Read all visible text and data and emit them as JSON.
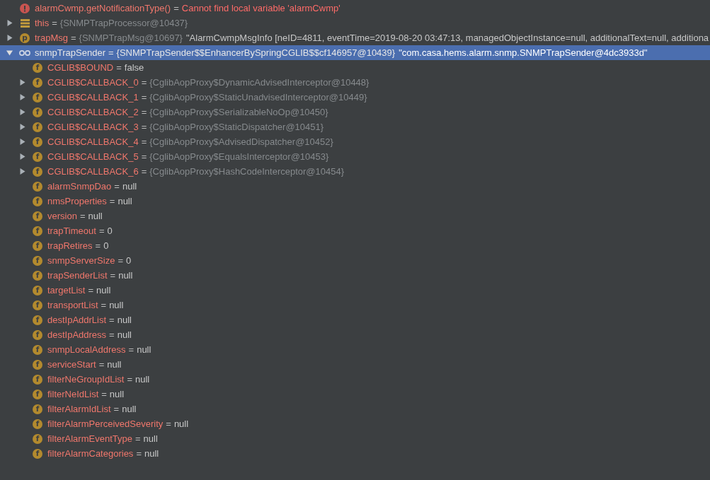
{
  "variables": [
    {
      "kind": "error",
      "name": "alarmCwmp.getNotificationType()",
      "op": "=",
      "message": "Cannot find local variable 'alarmCwmp'",
      "selected": false
    },
    {
      "kind": "object",
      "name": "this",
      "op": "=",
      "ref": "{SNMPTrapProcessor@10437}",
      "expanded": false,
      "selected": false
    },
    {
      "kind": "param",
      "badge": "p",
      "name": "trapMsg",
      "op": "=",
      "ref": "{SNMPTrapMsg@10697}",
      "value": "\"AlarmCwmpMsgInfo [neID=4811, eventTime=2019-08-20 03:47:13, managedObjectInstance=null, additionalText=null, additiona",
      "expanded": false,
      "selected": false
    },
    {
      "kind": "watch",
      "name": "snmpTrapSender",
      "op": "=",
      "ref": "{SNMPTrapSender$$EnhancerBySpringCGLIB$$cf146957@10439}",
      "value": "\"com.casa.hems.alarm.snmp.SNMPTrapSender@4dc3933d\"",
      "expanded": true,
      "selected": true,
      "children": [
        {
          "kind": "field",
          "badge": "f",
          "name": "CGLIB$BOUND",
          "op": "=",
          "value": "false",
          "selected": false
        },
        {
          "kind": "field",
          "badge": "f",
          "name": "CGLIB$CALLBACK_0",
          "op": "=",
          "ref": "{CglibAopProxy$DynamicAdvisedInterceptor@10448}",
          "expanded": false,
          "selected": false
        },
        {
          "kind": "field",
          "badge": "f",
          "name": "CGLIB$CALLBACK_1",
          "op": "=",
          "ref": "{CglibAopProxy$StaticUnadvisedInterceptor@10449}",
          "expanded": false,
          "selected": false
        },
        {
          "kind": "field",
          "badge": "f",
          "name": "CGLIB$CALLBACK_2",
          "op": "=",
          "ref": "{CglibAopProxy$SerializableNoOp@10450}",
          "expanded": false,
          "selected": false
        },
        {
          "kind": "field",
          "badge": "f",
          "name": "CGLIB$CALLBACK_3",
          "op": "=",
          "ref": "{CglibAopProxy$StaticDispatcher@10451}",
          "expanded": false,
          "selected": false
        },
        {
          "kind": "field",
          "badge": "f",
          "name": "CGLIB$CALLBACK_4",
          "op": "=",
          "ref": "{CglibAopProxy$AdvisedDispatcher@10452}",
          "expanded": false,
          "selected": false
        },
        {
          "kind": "field",
          "badge": "f",
          "name": "CGLIB$CALLBACK_5",
          "op": "=",
          "ref": "{CglibAopProxy$EqualsInterceptor@10453}",
          "expanded": false,
          "selected": false
        },
        {
          "kind": "field",
          "badge": "f",
          "name": "CGLIB$CALLBACK_6",
          "op": "=",
          "ref": "{CglibAopProxy$HashCodeInterceptor@10454}",
          "expanded": false,
          "selected": false
        },
        {
          "kind": "field",
          "badge": "f",
          "name": "alarmSnmpDao",
          "op": "=",
          "value": "null",
          "selected": false
        },
        {
          "kind": "field",
          "badge": "f",
          "name": "nmsProperties",
          "op": "=",
          "value": "null",
          "selected": false
        },
        {
          "kind": "field",
          "badge": "f",
          "name": "version",
          "op": "=",
          "value": "null",
          "selected": false
        },
        {
          "kind": "field",
          "badge": "f",
          "name": "trapTimeout",
          "op": "=",
          "value": "0",
          "selected": false
        },
        {
          "kind": "field",
          "badge": "f",
          "name": "trapRetires",
          "op": "=",
          "value": "0",
          "selected": false
        },
        {
          "kind": "field",
          "badge": "f",
          "name": "snmpServerSize",
          "op": "=",
          "value": "0",
          "selected": false
        },
        {
          "kind": "field",
          "badge": "f",
          "name": "trapSenderList",
          "op": "=",
          "value": "null",
          "selected": false
        },
        {
          "kind": "field",
          "badge": "f",
          "name": "targetList",
          "op": "=",
          "value": "null",
          "selected": false
        },
        {
          "kind": "field",
          "badge": "f",
          "name": "transportList",
          "op": "=",
          "value": "null",
          "selected": false
        },
        {
          "kind": "field",
          "badge": "f",
          "name": "destIpAddrList",
          "op": "=",
          "value": "null",
          "selected": false
        },
        {
          "kind": "field",
          "badge": "f",
          "name": "destIpAddress",
          "op": "=",
          "value": "null",
          "selected": false
        },
        {
          "kind": "field",
          "badge": "f",
          "name": "snmpLocalAddress",
          "op": "=",
          "value": "null",
          "selected": false
        },
        {
          "kind": "field",
          "badge": "f",
          "name": "serviceStart",
          "op": "=",
          "value": "null",
          "selected": false
        },
        {
          "kind": "field",
          "badge": "f",
          "name": "filterNeGroupIdList",
          "op": "=",
          "value": "null",
          "selected": false
        },
        {
          "kind": "field",
          "badge": "f",
          "name": "filterNeIdList",
          "op": "=",
          "value": "null",
          "selected": false
        },
        {
          "kind": "field",
          "badge": "f",
          "name": "filterAlarmIdList",
          "op": "=",
          "value": "null",
          "selected": false
        },
        {
          "kind": "field",
          "badge": "f",
          "name": "filterAlarmPerceivedSeverity",
          "op": "=",
          "value": "null",
          "selected": false
        },
        {
          "kind": "field",
          "badge": "f",
          "name": "filterAlarmEventType",
          "op": "=",
          "value": "null",
          "selected": false
        },
        {
          "kind": "field",
          "badge": "f",
          "name": "filterAlarmCategories",
          "op": "=",
          "value": "null",
          "selected": false
        }
      ]
    }
  ]
}
